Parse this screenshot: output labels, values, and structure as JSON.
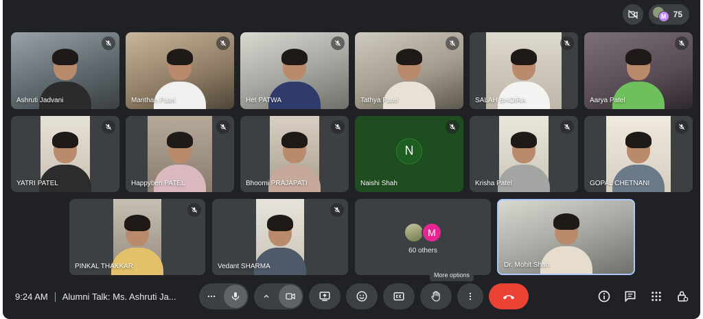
{
  "header": {
    "people_count": "75",
    "people_avatar_letter": "M"
  },
  "tiles": [
    {
      "name": "Ashruti Jadvani"
    },
    {
      "name": "Manthan Patel"
    },
    {
      "name": "Het PATWA"
    },
    {
      "name": "Tathya Patel"
    },
    {
      "name": "SALAH BHOIRA"
    },
    {
      "name": "Aarya Patel"
    },
    {
      "name": "YATRI PATEL"
    },
    {
      "name": "Happyben PATEL"
    },
    {
      "name": "Bhoomi PRAJAPATI"
    },
    {
      "name": "Naishi Shah",
      "avatar_letter": "N"
    },
    {
      "name": "Krisha Patel"
    },
    {
      "name": "GOPAL CHETNANI"
    },
    {
      "name": "PINKAL THAKKAR"
    },
    {
      "name": "Vedant SHARMA"
    },
    {
      "name": "Dr. Mohit Shah"
    }
  ],
  "others": {
    "avatar_letter": "M",
    "label": "60 others"
  },
  "meeting": {
    "time": "9:24 AM",
    "title": "Alumni Talk: Ms. Ashruti Ja..."
  },
  "tooltip": "More options",
  "colors": {
    "background": "#202124",
    "tile": "#3c4043",
    "end_call": "#ea4335",
    "self_border": "#a8c7fa",
    "naishi_tile": "#1e4d1f"
  }
}
